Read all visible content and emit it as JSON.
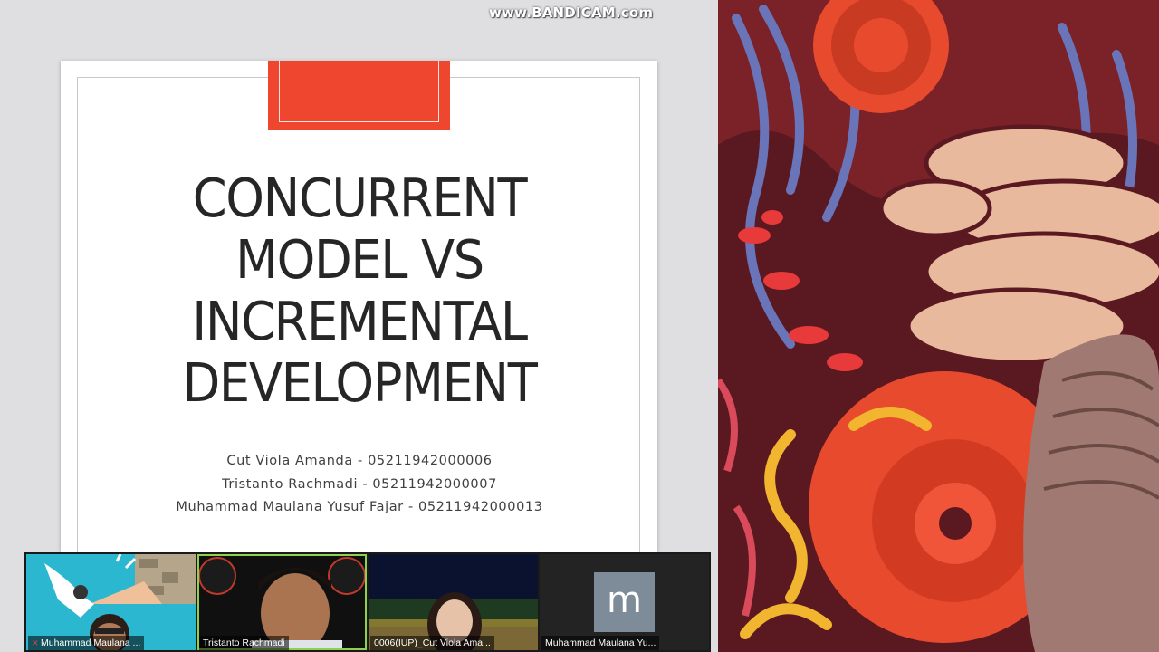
{
  "watermark": "www.BANDICAM.com",
  "slide": {
    "title_lines": [
      "CONCURRENT",
      "MODEL VS",
      "INCREMENTAL",
      "DEVELOPMENT"
    ],
    "authors": [
      "Cut Viola Amanda - 05211942000006",
      "Tristanto Rachmadi - 05211942000007",
      "Muhammad Maulana Yusuf Fajar - 05211942000013"
    ],
    "accent_color": "#ef4630"
  },
  "participants": [
    {
      "name": "Muhammad Maulana ...",
      "muted": true
    },
    {
      "name": "Tristanto Rachmadi",
      "muted": false,
      "active_speaker": true
    },
    {
      "name": "0006(IUP)_Cut Viola Ama...",
      "muted": false
    },
    {
      "name": "Muhammad Maulana Yu...",
      "muted": false,
      "avatar_letter": "m"
    }
  ]
}
